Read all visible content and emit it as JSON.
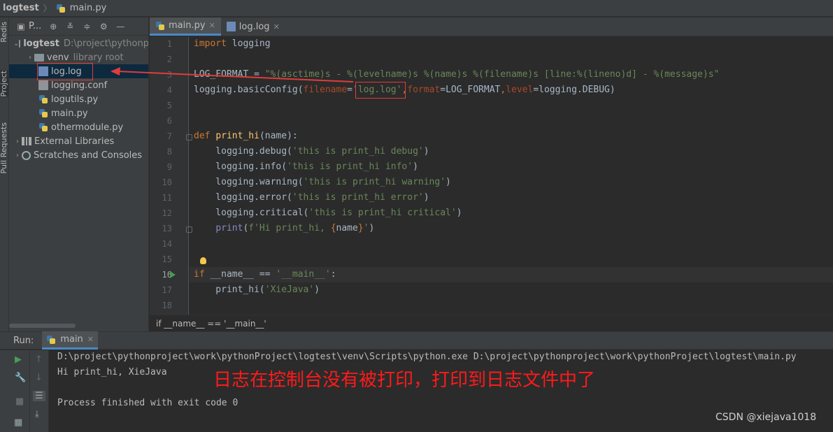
{
  "breadcrumb": {
    "project": "logtest",
    "file": "main.py"
  },
  "left_strip": {
    "tabs": [
      "Redis",
      "Project",
      "Pull Requests"
    ]
  },
  "project_panel": {
    "title": "P...",
    "tree": [
      {
        "label": "logtest",
        "hint": "D:\\project\\pythonp"
      },
      {
        "label": "venv",
        "hint": "library root"
      },
      {
        "label": "log.log"
      },
      {
        "label": "logging.conf"
      },
      {
        "label": "logutils.py"
      },
      {
        "label": "main.py"
      },
      {
        "label": "othermodule.py"
      },
      {
        "label": "External Libraries"
      },
      {
        "label": "Scratches and Consoles"
      }
    ]
  },
  "editor": {
    "tabs": [
      {
        "label": "main.py"
      },
      {
        "label": "log.log"
      }
    ],
    "line_numbers": [
      "1",
      "2",
      "3",
      "4",
      "5",
      "6",
      "7",
      "8",
      "9",
      "10",
      "11",
      "12",
      "13",
      "14",
      "15",
      "16",
      "17",
      "18"
    ],
    "lines": {
      "l1_kw": "import",
      "l1_rest": " logging",
      "l3_var": "LOG_FORMAT = ",
      "l3_str": "\"%(asctime)s - %(levelname)s %(name)s %(filename)s [line:%(lineno)d] - %(message)s\"",
      "l4_a": "logging.basicConfig(",
      "l4_p1": "filename",
      "l4_eq1": "=",
      "l4_s1": "'log.log'",
      "l4_c1": ",",
      "l4_p2": "format",
      "l4_b": "=LOG_FORMAT",
      "l4_c2": ",",
      "l4_p3": "level",
      "l4_c": "=logging.DEBUG)",
      "l7_kw": "def ",
      "l7_fn": "print_hi",
      "l7_rest": "(name):",
      "l8_a": "    logging.debug(",
      "l8_s": "'this is print_hi debug'",
      "l8_b": ")",
      "l9_a": "    logging.info(",
      "l9_s": "'this is print_hi info'",
      "l9_b": ")",
      "l10_a": "    logging.warning(",
      "l10_s": "'this is print_hi warning'",
      "l10_b": ")",
      "l11_a": "    logging.error(",
      "l11_s": "'this is print_hi error'",
      "l11_b": ")",
      "l12_a": "    logging.critical(",
      "l12_s": "'this is print_hi critical'",
      "l12_b": ")",
      "l13_pad": "    ",
      "l13_bi": "print",
      "l13_a": "(",
      "l13_s1": "f'Hi print_hi, ",
      "l13_br1": "{",
      "l13_v": "name",
      "l13_br2": "}",
      "l13_s2": "'",
      "l13_b": ")",
      "l16_kw": "if ",
      "l16_a": "__name__ == ",
      "l16_s": "'__main__'",
      "l16_b": ":",
      "l17_a": "    print_hi(",
      "l17_s": "'XieJava'",
      "l17_b": ")"
    },
    "crumb": "if __name__ == '__main__'"
  },
  "run": {
    "label": "Run:",
    "tab": "main",
    "console": [
      "D:\\project\\pythonproject\\work\\pythonProject\\logtest\\venv\\Scripts\\python.exe D:\\project\\pythonproject\\work\\pythonProject\\logtest\\main.py",
      "Hi print_hi, XieJava",
      "",
      "Process finished with exit code 0"
    ],
    "annotation": "日志在控制台没有被打印，打印到日志文件中了",
    "watermark": "CSDN @xiejava1018"
  },
  "colors": {
    "annotation": "#e03c3c",
    "accent": "#4a88c7",
    "keyword": "#cc7832",
    "string": "#6a8759"
  }
}
